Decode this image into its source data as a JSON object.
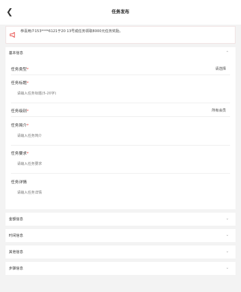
{
  "header": {
    "title": "任务发布",
    "back_icon": "chevron-left-icon"
  },
  "notice": {
    "text": "恭喜用户153****6121于20 13号成任务领取8000元任务奖励。",
    "icon": "megaphone-icon",
    "icon_color": "#e53935"
  },
  "basic": {
    "label": "基本信息",
    "fields": [
      {
        "label": "任务类型",
        "required": "*",
        "value": "请选择"
      },
      {
        "label": "任务标题",
        "required": "*",
        "placeholder": "请输入任务标题(5-20字)"
      },
      {
        "label": "任务级别",
        "required": "*",
        "value": "所有会员"
      },
      {
        "label": "任务简介",
        "required": "*",
        "placeholder": "请输入任务简介"
      },
      {
        "label": "任务要求",
        "required": "*",
        "placeholder": "请输入任务要求"
      },
      {
        "label": "任务详情",
        "required": "",
        "placeholder": "请输入任务详情"
      }
    ]
  },
  "sections": [
    {
      "label": "金额信息"
    },
    {
      "label": "时间信息"
    },
    {
      "label": "其他信息"
    },
    {
      "label": "步骤信息"
    }
  ],
  "colors": {
    "background": "#f3f3f3",
    "card": "#ffffff",
    "required": "#e53935"
  }
}
